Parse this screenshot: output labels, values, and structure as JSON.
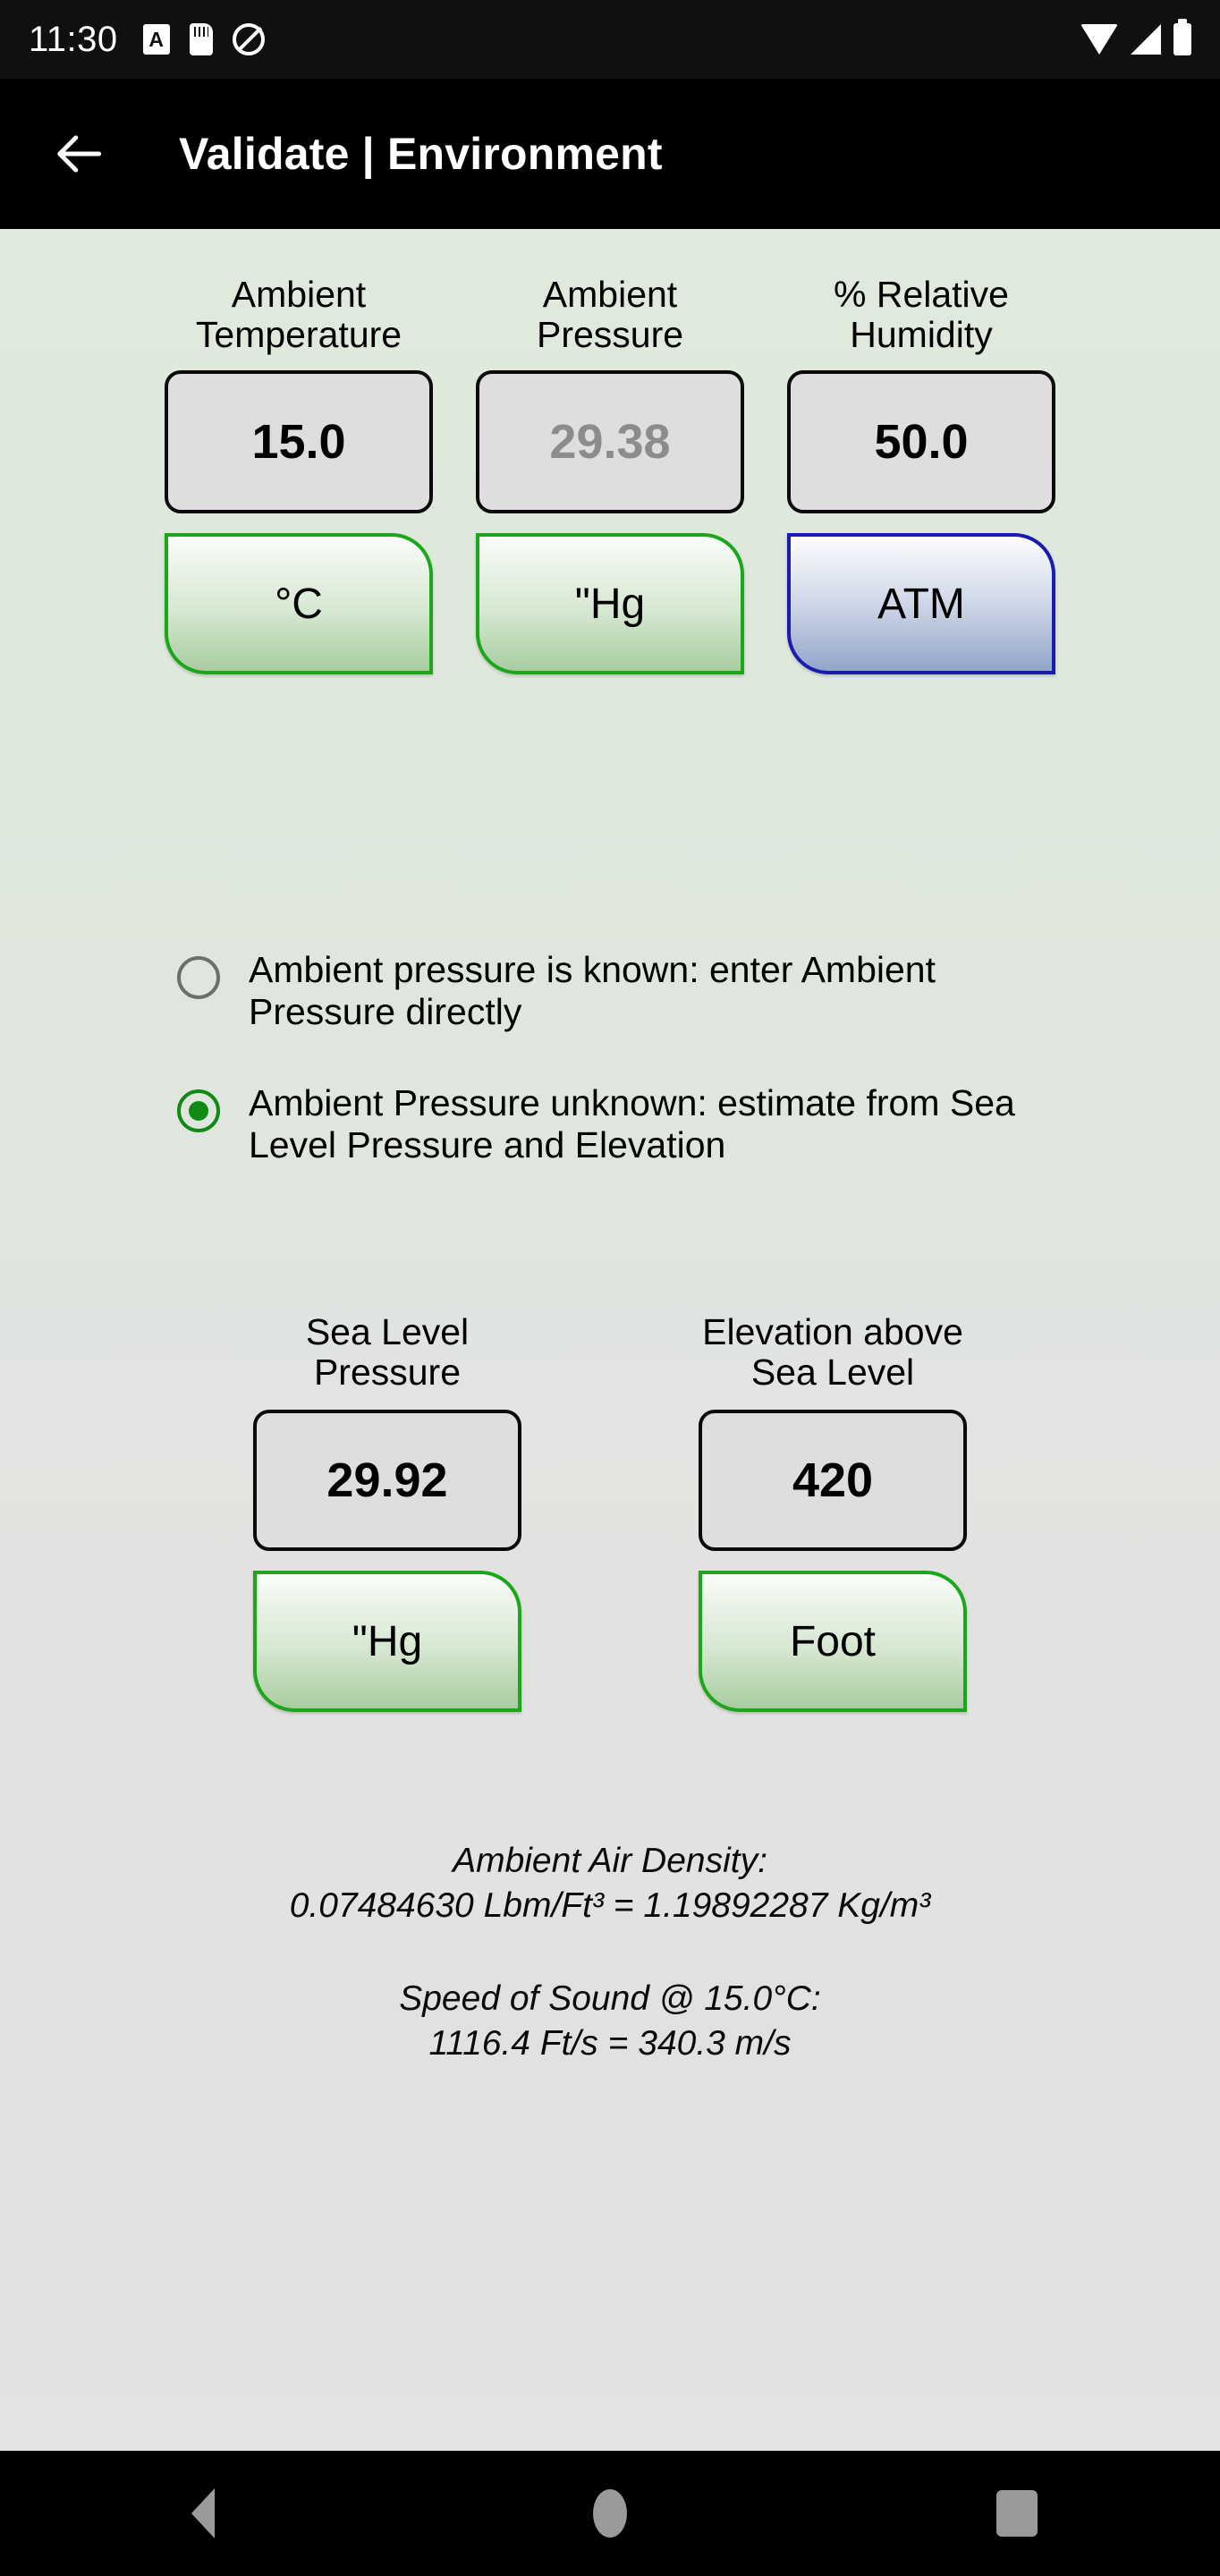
{
  "status_bar": {
    "time": "11:30",
    "left_icons": [
      "alpha-badge-icon",
      "sim-card-icon",
      "do-not-disturb-icon"
    ],
    "right_icons": [
      "wifi-icon",
      "cell-signal-icon",
      "battery-icon"
    ]
  },
  "app_bar": {
    "back_icon": "back-arrow-icon",
    "title": "Validate | Environment"
  },
  "top_fields": [
    {
      "label_line1": "Ambient",
      "label_line2": "Temperature",
      "value": "15.0",
      "readonly": false,
      "unit": "°C",
      "unit_style": "green"
    },
    {
      "label_line1": "Ambient",
      "label_line2": "Pressure",
      "value": "29.38",
      "readonly": true,
      "unit": "\"Hg",
      "unit_style": "green"
    },
    {
      "label_line1": "% Relative",
      "label_line2": "Humidity",
      "value": "50.0",
      "readonly": false,
      "unit": "ATM",
      "unit_style": "blue"
    }
  ],
  "radio_options": [
    {
      "label": "Ambient pressure is known: enter Ambient Pressure directly",
      "selected": false
    },
    {
      "label": "Ambient Pressure unknown: estimate from Sea Level Pressure and Elevation",
      "selected": true
    }
  ],
  "mid_fields": [
    {
      "label_line1": "Sea Level",
      "label_line2": "Pressure",
      "value": "29.92",
      "readonly": false,
      "unit": "\"Hg",
      "unit_style": "green"
    },
    {
      "label_line1": "Elevation above",
      "label_line2": "Sea Level",
      "value": "420",
      "readonly": false,
      "unit": "Foot",
      "unit_style": "green"
    }
  ],
  "results": [
    {
      "title": "Ambient Air Density:",
      "value": "0.07484630 Lbm/Ft³ = 1.19892287 Kg/m³"
    },
    {
      "title": "Speed of Sound @ 15.0°C:",
      "value": "1116.4 Ft/s = 340.3 m/s"
    }
  ],
  "nav_bar": {
    "back_label": "back-triangle-icon",
    "home_label": "home-circle-icon",
    "recents_label": "recents-square-icon"
  },
  "colors": {
    "accent_green": "#1aa71a",
    "accent_blue": "#1b1bb0",
    "radio_selected": "#0f8a14",
    "background_top": "#dfe9dc",
    "background_bottom": "#e3e3e3",
    "readonly_text": "#8c8c8c"
  }
}
